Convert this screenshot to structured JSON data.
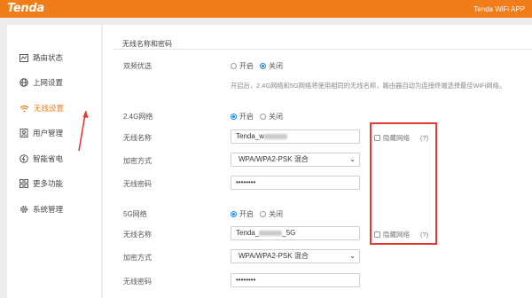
{
  "header": {
    "logo": "Tenda",
    "app_label": "Tenda WiFi APP"
  },
  "sidebar": {
    "items": [
      {
        "label": "路由状态",
        "icon": "status-icon"
      },
      {
        "label": "上网设置",
        "icon": "globe-icon"
      },
      {
        "label": "无线设置",
        "icon": "wifi-icon",
        "active": true
      },
      {
        "label": "用户管理",
        "icon": "user-icon"
      },
      {
        "label": "智能省电",
        "icon": "power-icon"
      },
      {
        "label": "更多功能",
        "icon": "grid-icon"
      },
      {
        "label": "系统管理",
        "icon": "gear-icon"
      }
    ]
  },
  "main": {
    "section_title": "无线名称和密码",
    "dual_band": {
      "label": "双频优选",
      "on": "开启",
      "off": "关闭",
      "selected": "关闭"
    },
    "hint": "开启后，2.4G网络和5G网络将使用相同的无线名称，路由器自动为连接终端选择最佳WiFi网络。",
    "band24": {
      "label": "2.4G网络",
      "on": "开启",
      "off": "关闭",
      "selected": "开启",
      "ssid_label": "无线名称",
      "ssid_prefix": "Tenda_w",
      "ssid_suffix": "",
      "enc_label": "加密方式",
      "enc_value": "WPA/WPA2-PSK 混合",
      "pwd_label": "无线密码",
      "pwd_value": "••••••••",
      "hide_label": "隐藏网络",
      "help": "(?)"
    },
    "band5": {
      "label": "5G网络",
      "on": "开启",
      "off": "关闭",
      "selected": "开启",
      "ssid_label": "无线名称",
      "ssid_prefix": "Tenda_",
      "ssid_suffix": "_5G",
      "enc_label": "加密方式",
      "enc_value": "WPA/WPA2-PSK 混合",
      "pwd_label": "无线密码",
      "pwd_value": "••••••••",
      "hide_label": "隐藏网络",
      "help": "(?)"
    }
  },
  "colors": {
    "brand": "#f07d19",
    "radio": "#1e88e5",
    "highlight": "#e53935"
  }
}
